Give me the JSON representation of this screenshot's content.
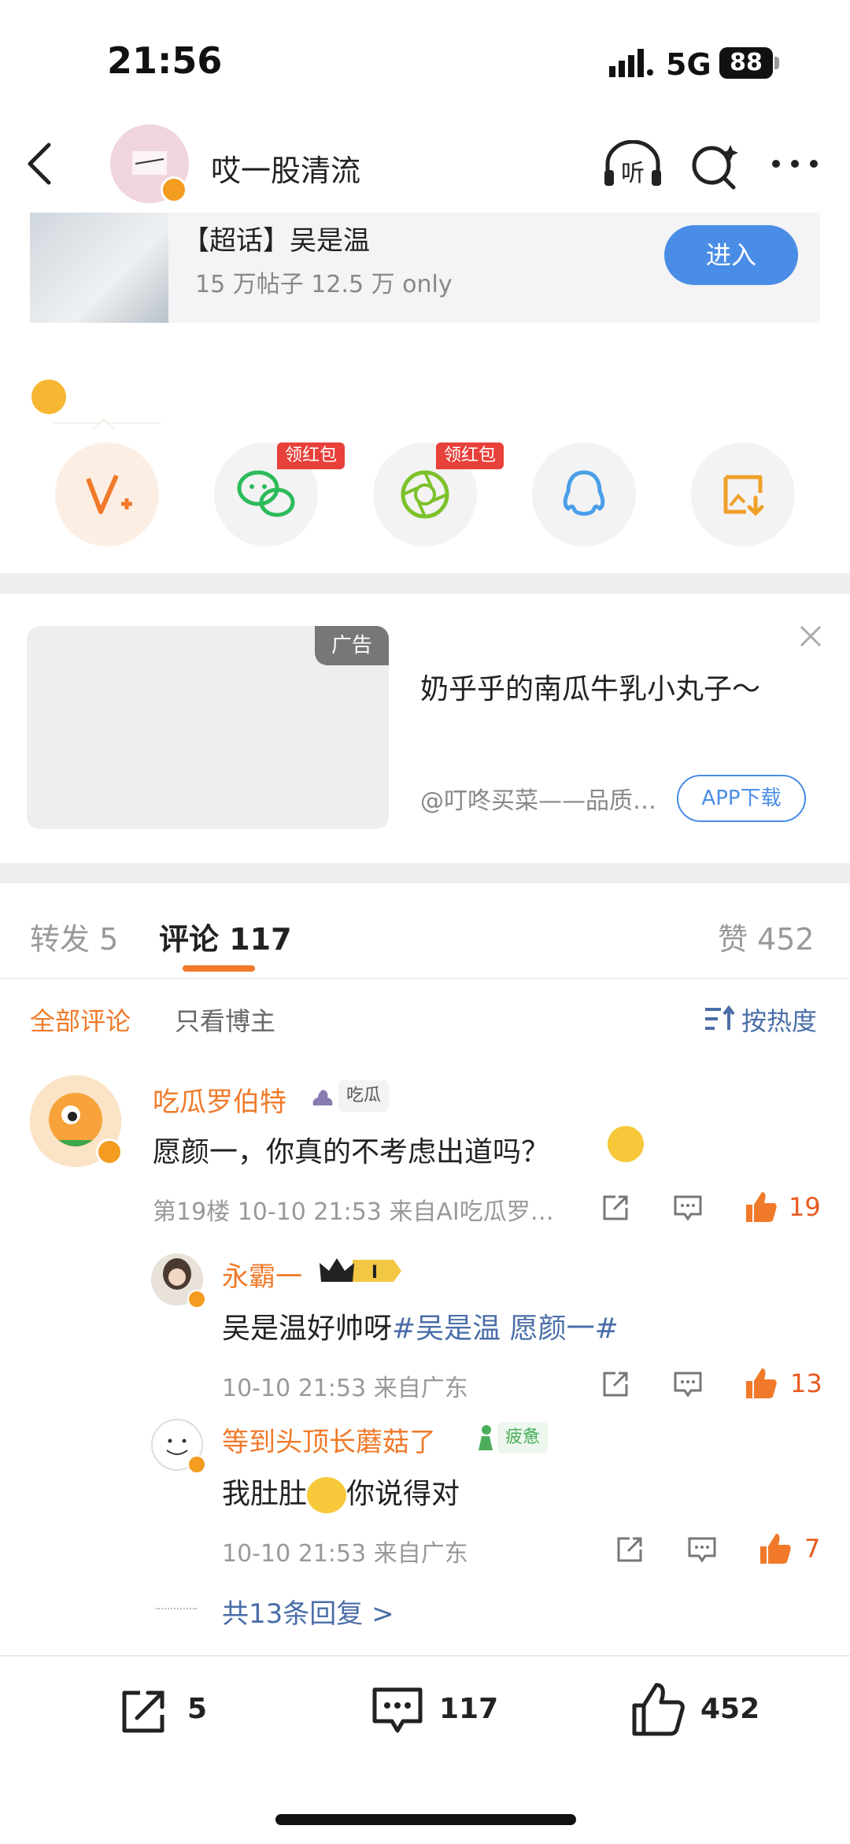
{
  "status": {
    "time": "21:56",
    "network": "5G",
    "battery": "88"
  },
  "header": {
    "title": "哎一股清流"
  },
  "topic": {
    "name": "【超话】吴是温",
    "stats": "15 万帖子 12.5 万 only",
    "enter_label": "进入"
  },
  "share": {
    "wechat_badge": "领红包",
    "moments_badge": "领红包"
  },
  "ad": {
    "tag": "广告",
    "title": "奶乎乎的南瓜牛乳小丸子～",
    "source": "@叮咚买菜——品质…",
    "download_label": "APP下载"
  },
  "tabs": {
    "repost": "转发 5",
    "comment": "评论 117",
    "like": "赞 452"
  },
  "filters": {
    "all": "全部评论",
    "author_only": "只看博主",
    "sort": "按热度"
  },
  "comments": [
    {
      "name": "吃瓜罗伯特",
      "tag": "吃瓜",
      "text": "愿颜一，你真的不考虑出道吗？",
      "meta": "第19楼 10-10 21:53 来自AI吃瓜罗…",
      "likes": "19"
    },
    {
      "name": "永霸一",
      "text_prefix": "吴是温好帅呀",
      "text_hash": "#吴是温 愿颜一#",
      "meta": "10-10 21:53 来自广东",
      "likes": "13"
    },
    {
      "name": "等到头顶长蘑菇了",
      "tag": "疲惫",
      "text_prefix": "我肚肚",
      "text_suffix": "你说得对",
      "meta": "10-10 21:53 来自广东",
      "likes": "7"
    }
  ],
  "more_replies": "共13条回复 >",
  "bottom": {
    "repost": "5",
    "comment": "117",
    "like": "452"
  },
  "colors": {
    "accent": "#f07a2a",
    "link": "#4a6ea8",
    "blue": "#4a8de6"
  }
}
